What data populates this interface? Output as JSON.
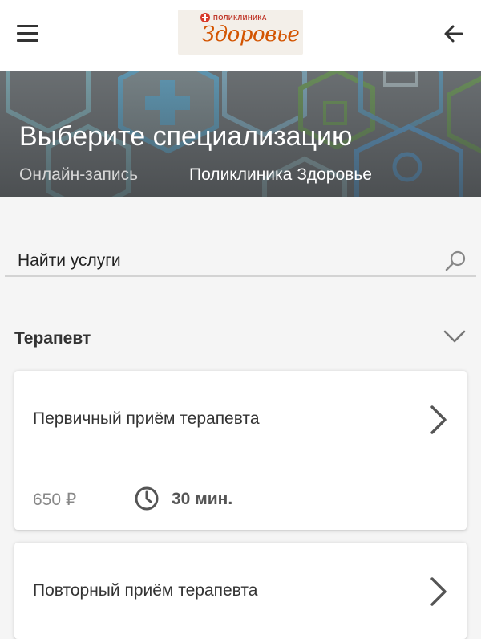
{
  "header": {
    "logo_small": "ПОЛИКЛИНИКА",
    "logo_big": "Здоровье",
    "menu_icon": "hamburger-menu-icon",
    "back_icon": "arrow-back-icon"
  },
  "hero": {
    "title": "Выберите специализацию",
    "breadcrumbs": [
      "Онлайн-запись",
      "Поликлиника Здоровье"
    ]
  },
  "search": {
    "placeholder": "Найти услуги",
    "icon": "search-icon"
  },
  "section": {
    "title": "Терапевт",
    "toggle_icon": "chevron-down-icon"
  },
  "services": [
    {
      "title": "Первичный приём терапевта",
      "price": "650 ₽",
      "duration": "30 мин."
    },
    {
      "title": "Повторный приём терапевта"
    }
  ],
  "colors": {
    "logo_red": "#d83a2a",
    "logo_orange": "#d35400",
    "hero_bg": "#6c7174"
  }
}
